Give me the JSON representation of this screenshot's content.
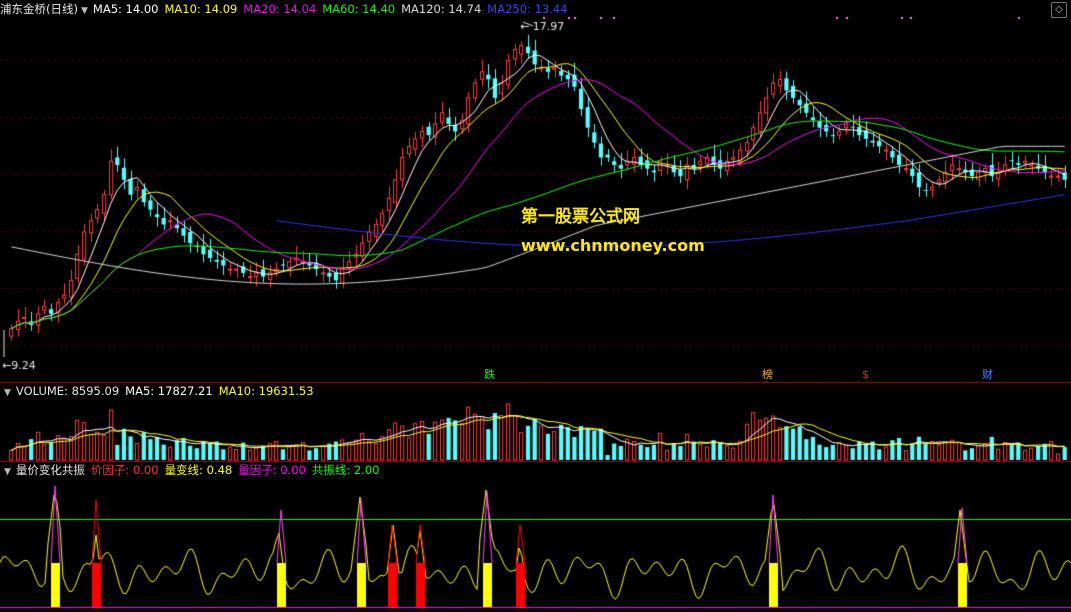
{
  "header": {
    "title": "浦东金桥(日线)",
    "ma_items": [
      {
        "text": "MA5: 14.00",
        "color": "#ffffff"
      },
      {
        "text": "MA10: 14.09",
        "color": "#ffff00"
      },
      {
        "text": "MA20: 14.04",
        "color": "#ff00ff"
      },
      {
        "text": "MA60: 14.40",
        "color": "#00ff00"
      },
      {
        "text": "MA120: 14.74",
        "color": "#d8d8d8"
      },
      {
        "text": "MA250: 13.44",
        "color": "#3a3aff"
      }
    ]
  },
  "volume_header": {
    "title": "VOLUME: 8595.09",
    "ma_items": [
      {
        "text": "MA5: 17827.21",
        "color": "#ffffff"
      },
      {
        "text": "MA10: 19631.53",
        "color": "#ffff00"
      }
    ]
  },
  "indicator_header": {
    "title": "量价变化共振",
    "items": [
      {
        "text": "价因子: 0.00",
        "color": "#ff3030"
      },
      {
        "text": "量变线: 0.48",
        "color": "#ffff00"
      },
      {
        "text": "量因子: 0.00",
        "color": "#ff00ff"
      },
      {
        "text": "共振线: 2.00",
        "color": "#00ff00"
      }
    ]
  },
  "watermark": {
    "line1": "第一股票公式网",
    "line2": "www.chnmoney.com"
  },
  "events": [
    {
      "label": "跌",
      "color": "#00ff00"
    },
    {
      "label": "榜",
      "color": "#ffb000"
    },
    {
      "label": "$",
      "color": "#ff2020"
    },
    {
      "label": "财",
      "color": "#3a8cff"
    }
  ],
  "chart_data": [
    {
      "type": "candlestick",
      "panel": "price",
      "high_marker": "17.97",
      "low_marker": "9.24",
      "y_range": [
        9.0,
        18.4
      ],
      "candle_count": 160,
      "closes": [
        10.0,
        10.2,
        10.3,
        10.1,
        10.4,
        10.6,
        10.4,
        10.7,
        10.9,
        11.3,
        12.0,
        12.6,
        12.9,
        13.2,
        13.6,
        14.5,
        14.4,
        14.0,
        13.6,
        13.8,
        13.4,
        13.2,
        13.0,
        12.8,
        12.9,
        12.7,
        12.5,
        12.3,
        12.2,
        12.0,
        11.9,
        11.8,
        11.7,
        11.6,
        11.6,
        11.5,
        11.4,
        11.5,
        11.4,
        11.5,
        11.6,
        11.7,
        11.8,
        11.9,
        11.8,
        11.7,
        11.6,
        11.5,
        11.4,
        11.3,
        11.6,
        11.8,
        12.0,
        12.3,
        12.6,
        12.8,
        13.1,
        13.5,
        14.0,
        14.6,
        14.9,
        15.1,
        15.3,
        15.2,
        15.5,
        15.8,
        15.5,
        15.3,
        15.6,
        16.2,
        16.6,
        16.9,
        16.7,
        16.2,
        16.6,
        17.2,
        17.5,
        17.6,
        17.4,
        17.1,
        17.0,
        16.9,
        17.0,
        16.8,
        16.7,
        16.5,
        15.9,
        15.4,
        15.0,
        14.6,
        14.6,
        14.4,
        14.3,
        14.5,
        14.6,
        14.4,
        14.3,
        14.2,
        14.5,
        14.4,
        14.2,
        14.1,
        14.4,
        14.3,
        14.5,
        14.6,
        14.4,
        14.3,
        14.5,
        14.6,
        14.8,
        15.0,
        15.4,
        15.8,
        16.2,
        16.6,
        16.7,
        16.4,
        16.2,
        16.0,
        15.8,
        15.6,
        15.4,
        15.3,
        15.2,
        15.3,
        15.5,
        15.4,
        15.2,
        15.1,
        15.0,
        14.9,
        14.8,
        14.6,
        14.4,
        14.3,
        14.1,
        13.8,
        13.7,
        13.8,
        14.0,
        14.2,
        14.4,
        14.3,
        14.2,
        14.1,
        14.2,
        14.3,
        14.1,
        14.2,
        14.4,
        14.5,
        14.4,
        14.5,
        14.4,
        14.3,
        14.2,
        14.1,
        14.1,
        14.0
      ]
    },
    {
      "type": "bar",
      "panel": "volume",
      "title": "VOLUME"
    },
    {
      "type": "line",
      "panel": "indicator",
      "title": "量价变化共振",
      "resonance_line": 2.0
    }
  ]
}
